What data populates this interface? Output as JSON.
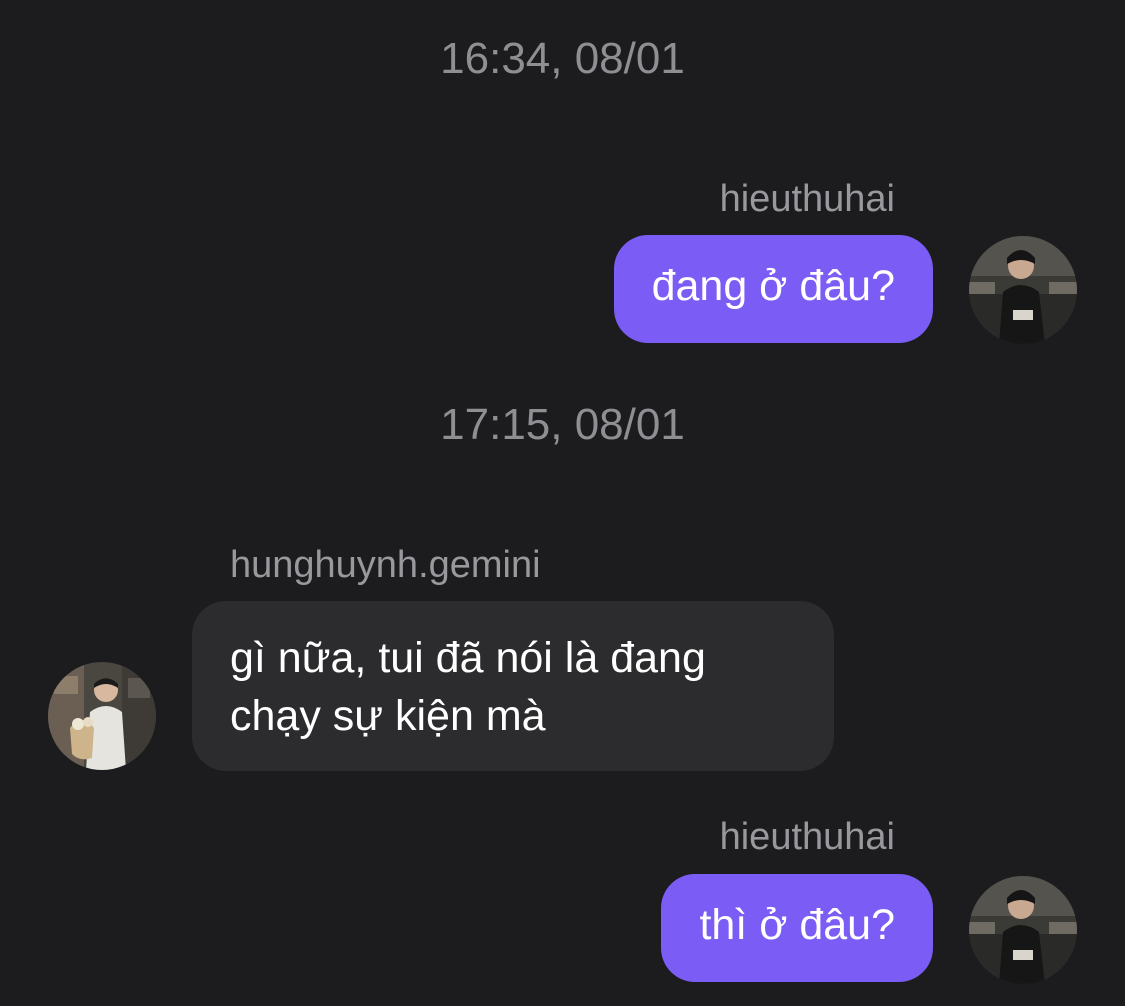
{
  "thread": {
    "timestamps": [
      "16:34, 08/01",
      "17:15, 08/01"
    ],
    "messages": [
      {
        "sender": "hieuthuhai",
        "text": "đang ở đâu?",
        "direction": "outgoing",
        "avatar": "user-avatar-hieuthuhai"
      },
      {
        "sender": "hunghuynh.gemini",
        "text": "gì nữa, tui đã nói là đang chạy sự kiện mà",
        "direction": "incoming",
        "avatar": "user-avatar-hunghuynh"
      },
      {
        "sender": "hieuthuhai",
        "text": "thì ở đâu?",
        "direction": "outgoing",
        "avatar": "user-avatar-hieuthuhai"
      }
    ]
  },
  "colors": {
    "background": "#1c1c1e",
    "outgoing_bubble": "#7b5cf5",
    "incoming_bubble": "#2c2c2e",
    "timestamp_text": "#8e8e93",
    "sender_text": "#98989d"
  }
}
